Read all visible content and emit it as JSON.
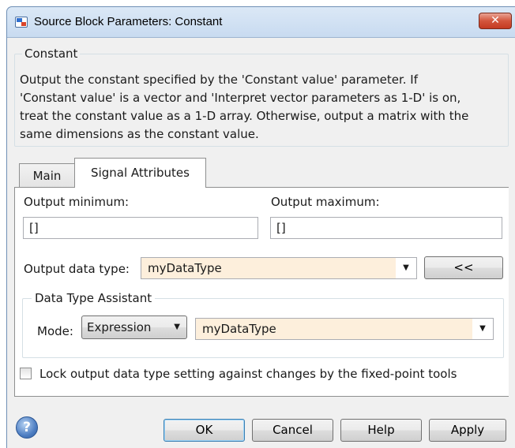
{
  "window": {
    "title": "Source Block Parameters: Constant",
    "close_glyph": "✕"
  },
  "description": {
    "group_label": "Constant",
    "lines": [
      "Output the constant specified by the 'Constant value' parameter. If",
      "'Constant value' is a vector and 'Interpret vector parameters as 1-D' is on,",
      "treat the constant value as a 1-D array. Otherwise, output a matrix with the",
      "same dimensions as the constant value."
    ]
  },
  "tabs": [
    {
      "label": "Main",
      "selected": false
    },
    {
      "label": "Signal Attributes",
      "selected": true
    }
  ],
  "signal_attributes": {
    "output_minimum_label": "Output minimum:",
    "output_minimum_value": "[]",
    "output_maximum_label": "Output maximum:",
    "output_maximum_value": "[]",
    "output_data_type_label": "Output data type:",
    "output_data_type_value": "myDataType",
    "assistant_toggle_label": "<<",
    "assistant": {
      "group_label": "Data Type Assistant",
      "mode_label": "Mode:",
      "mode_value": "Expression",
      "expression_value": "myDataType"
    },
    "lock_label": "Lock output data type setting against changes by the fixed-point tools",
    "lock_checked": false
  },
  "footer": {
    "help_icon": "question-icon",
    "help_glyph": "?",
    "ok_label": "OK",
    "cancel_label": "Cancel",
    "help_label": "Help",
    "apply_label": "Apply"
  },
  "colors": {
    "combo_background": "#fdefdc",
    "close_button": "#c43a21"
  }
}
